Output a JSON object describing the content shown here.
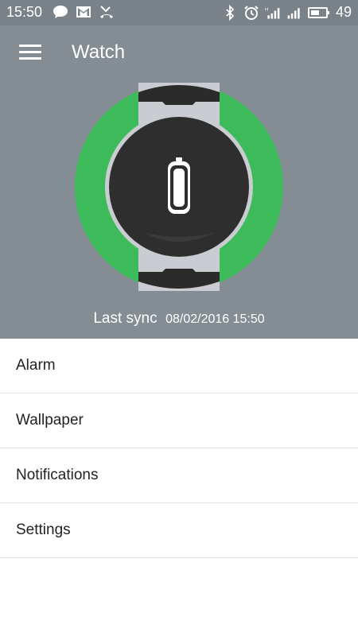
{
  "status_bar": {
    "time": "15:50",
    "battery_level": "49",
    "left_icons": [
      "chat-icon",
      "gmail-icon",
      "missed-call-icon"
    ],
    "right_icons": [
      "bluetooth-icon",
      "alarm-clock-icon",
      "signal-h-icon",
      "signal-icon",
      "battery-icon"
    ]
  },
  "header": {
    "title": "Watch",
    "background": "#858d94",
    "ring_color": "#3dbb5a",
    "watch_status": "battery-icon"
  },
  "sync": {
    "label": "Last sync",
    "value": "08/02/2016 15:50"
  },
  "menu": {
    "items": [
      {
        "label": "Alarm"
      },
      {
        "label": "Wallpaper"
      },
      {
        "label": "Notifications"
      },
      {
        "label": "Settings"
      }
    ]
  }
}
